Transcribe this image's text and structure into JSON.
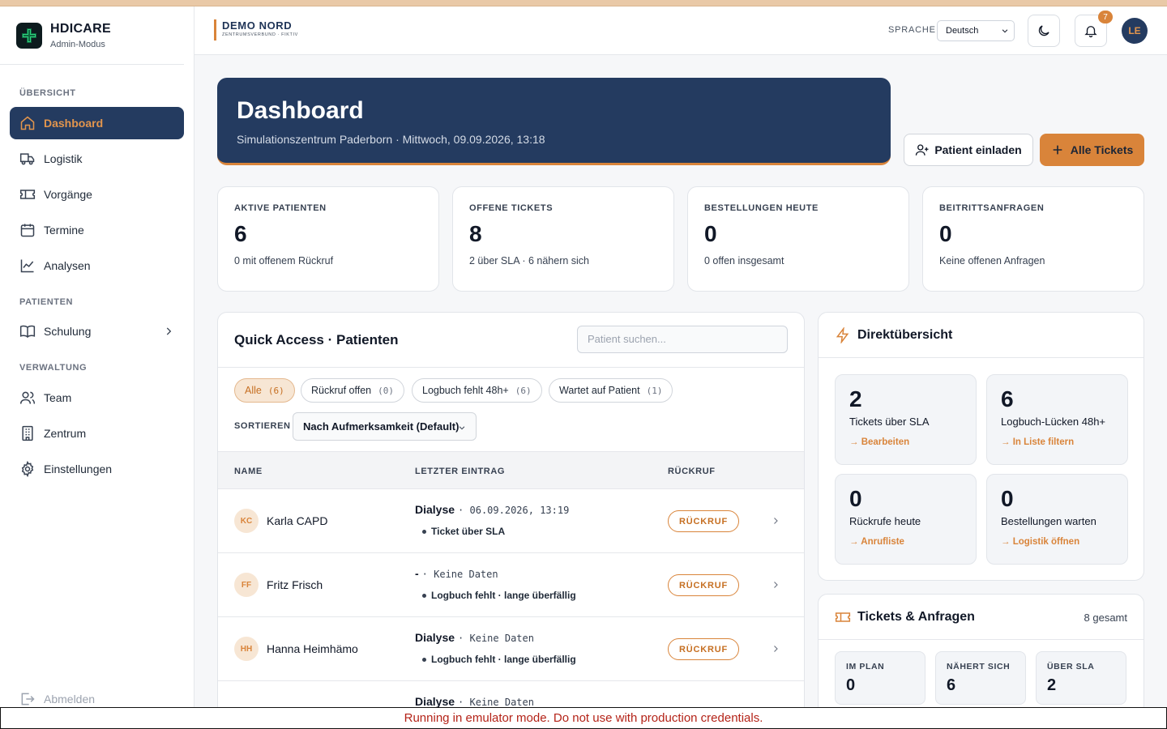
{
  "colors": {
    "accent": "#d9843a",
    "navy": "#243b60",
    "danger_text": "#b42318"
  },
  "brand": {
    "name": "HDICARE",
    "mode": "Admin-Modus"
  },
  "sidebar": {
    "sections": {
      "overview": "ÜBERSICHT",
      "patients": "PATIENTEN",
      "admin": "VERWALTUNG"
    },
    "items": [
      {
        "label": "Dashboard",
        "icon": "home-icon"
      },
      {
        "label": "Logistik",
        "icon": "truck-icon"
      },
      {
        "label": "Vorgänge",
        "icon": "ticket-icon"
      },
      {
        "label": "Termine",
        "icon": "calendar-icon"
      },
      {
        "label": "Analysen",
        "icon": "chart-line-icon"
      },
      {
        "label": "Schulung",
        "icon": "book-icon"
      },
      {
        "label": "Team",
        "icon": "users-icon"
      },
      {
        "label": "Zentrum",
        "icon": "building-icon"
      },
      {
        "label": "Einstellungen",
        "icon": "gear-icon"
      }
    ],
    "logout": "Abmelden"
  },
  "header": {
    "tenant_name": "DEMO NORD",
    "tenant_sub": "ZENTRUMSVERBUND · FIKTIV",
    "language_label": "SPRACHE",
    "language_value": "Deutsch",
    "notification_count": "7",
    "avatar_initials": "LE"
  },
  "hero": {
    "title": "Dashboard",
    "subtitle": "Simulationszentrum Paderborn · Mittwoch, 09.09.2026, 13:18"
  },
  "actions": {
    "invite": "Patient einladen",
    "all_tickets": "Alle Tickets"
  },
  "stats": [
    {
      "label": "AKTIVE PATIENTEN",
      "value": "6",
      "note": "0 mit offenem Rückruf"
    },
    {
      "label": "OFFENE TICKETS",
      "value": "8",
      "note": "2 über SLA · 6 nähern sich"
    },
    {
      "label": "BESTELLUNGEN HEUTE",
      "value": "0",
      "note": "0 offen insgesamt"
    },
    {
      "label": "BEITRITTSANFRAGEN",
      "value": "0",
      "note": "Keine offenen Anfragen"
    }
  ],
  "quick_access": {
    "title": "Quick Access · Patienten",
    "search_placeholder": "Patient suchen...",
    "filters": [
      {
        "label": "Alle",
        "count": "(6)"
      },
      {
        "label": "Rückruf offen",
        "count": "(0)"
      },
      {
        "label": "Logbuch fehlt 48h+",
        "count": "(6)"
      },
      {
        "label": "Wartet auf Patient",
        "count": "(1)"
      }
    ],
    "sort_label": "SORTIEREN",
    "sort_value": "Nach Aufmerksamkeit (Default)",
    "columns": [
      "NAME",
      "LETZTER EINTRAG",
      "RÜCKRUF"
    ],
    "rows": [
      {
        "initials": "KC",
        "name": "Karla CAPD",
        "entry": "Dialyse",
        "date": "· 06.09.2026, 13:19",
        "status": "Ticket über SLA",
        "callback": "RÜCKRUF"
      },
      {
        "initials": "FF",
        "name": "Fritz Frisch",
        "entry": "-",
        "date": "· Keine Daten",
        "status": "Logbuch fehlt · lange überfällig",
        "callback": "RÜCKRUF"
      },
      {
        "initials": "HH",
        "name": "Hanna Heimhämo",
        "entry": "Dialyse",
        "date": "· Keine Daten",
        "status": "Logbuch fehlt · lange überfällig",
        "callback": "RÜCKRUF"
      },
      {
        "initials": "",
        "name": "",
        "entry": "Dialyse",
        "date": "· Keine Daten",
        "status": "",
        "callback": ""
      }
    ]
  },
  "direct": {
    "title": "Direktübersicht",
    "tiles": [
      {
        "value": "2",
        "label": "Tickets über SLA",
        "link": "→ Bearbeiten"
      },
      {
        "value": "6",
        "label": "Logbuch-Lücken 48h+",
        "link": "→ In Liste filtern"
      },
      {
        "value": "0",
        "label": "Rückrufe heute",
        "link": "→ Anrufliste"
      },
      {
        "value": "0",
        "label": "Bestellungen warten",
        "link": "→ Logistik öffnen"
      }
    ]
  },
  "tickets": {
    "title": "Tickets & Anfragen",
    "total": "8 gesamt",
    "minis": [
      {
        "label": "IM PLAN",
        "value": "0"
      },
      {
        "label": "NÄHERT SICH",
        "value": "6"
      },
      {
        "label": "ÜBER SLA",
        "value": "2"
      }
    ]
  },
  "banner": "Running in emulator mode. Do not use with production credentials."
}
